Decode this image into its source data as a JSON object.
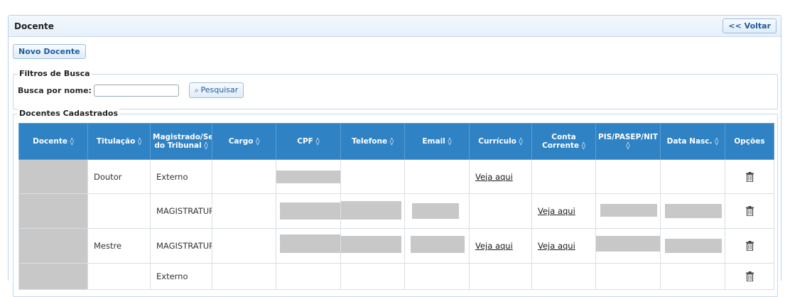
{
  "panel": {
    "title": "Docente",
    "back_label": "<< Voltar"
  },
  "new_button_label": "Novo Docente",
  "filters": {
    "legend": "Filtros de Busca",
    "search_label": "Busca por nome:",
    "search_value": "",
    "search_button_label": "Pesquisar"
  },
  "registered": {
    "legend": "Docentes Cadastrados",
    "columns": [
      "Docente ◊",
      "Titulação ◊",
      "Magistrado/Se do Tribunal ◊",
      "Cargo ◊",
      "CPF ◊",
      "Telefone ◊",
      "Email ◊",
      "Currículo ◊",
      "Conta Corrente ◊",
      "PIS/PASEP/NIT ◊",
      "Data Nasc. ◊",
      "Opções"
    ],
    "rows": [
      {
        "titulacao": "Doutor",
        "magistrado": "Externo",
        "curriculo": "Veja aqui",
        "conta": ""
      },
      {
        "titulacao": "",
        "magistrado": "MAGISTRATUR",
        "curriculo": "",
        "conta": "Veja aqui"
      },
      {
        "titulacao": "Mestre",
        "magistrado": "MAGISTRATUR",
        "curriculo": "Veja aqui",
        "conta": "Veja aqui"
      },
      {
        "titulacao": "",
        "magistrado": "Externo",
        "curriculo": "",
        "conta": ""
      }
    ]
  },
  "icons": {
    "delete": "trash-icon",
    "search": "search-icon"
  },
  "colors": {
    "header_bg": "#2f83c4",
    "accent": "#1f5b9c",
    "redacted": "#c8c8c8"
  }
}
